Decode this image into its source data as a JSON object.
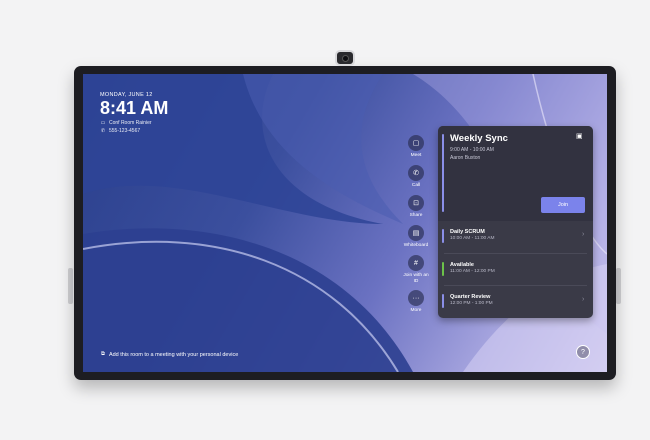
{
  "status": {
    "date": "MONDAY, JUNE 12",
    "time": "8:41 AM",
    "room": "Conf Room Rainier",
    "phone": "555-123-4567",
    "room_icon": "room-display-icon",
    "phone_icon": "phone-icon"
  },
  "actions": [
    {
      "label": "Meet",
      "icon": "video-camera-icon"
    },
    {
      "label": "Call",
      "icon": "phone-icon"
    },
    {
      "label": "Share",
      "icon": "screen-share-icon"
    },
    {
      "label": "Whiteboard",
      "icon": "whiteboard-icon"
    },
    {
      "label": "Join with an ID",
      "icon": "hashtag-icon"
    },
    {
      "label": "More",
      "icon": "more-icon"
    }
  ],
  "featured_meeting": {
    "title": "Weekly Sync",
    "time": "9:00 AM - 10:00 AM",
    "organizer": "Aaron Buxton",
    "join_label": "Join",
    "accent": "#8b8fe8"
  },
  "meetings": [
    {
      "name": "Daily SCRUM",
      "time": "10:00 AM - 11:00 AM",
      "color": "#8b8fe8",
      "has_chevron": true
    },
    {
      "name": "Available",
      "time": "11:00 AM - 12:00 PM",
      "color": "#6cc24a",
      "has_chevron": false
    },
    {
      "name": "Quarter Review",
      "time": "12:00 PM - 1:00 PM",
      "color": "#8b8fe8",
      "has_chevron": true
    }
  ],
  "bottom_hint": "Add this room to a meeting with your personal device",
  "help_label": "?",
  "colors": {
    "accent": "#7b83eb",
    "panel": "#3a3a47"
  }
}
